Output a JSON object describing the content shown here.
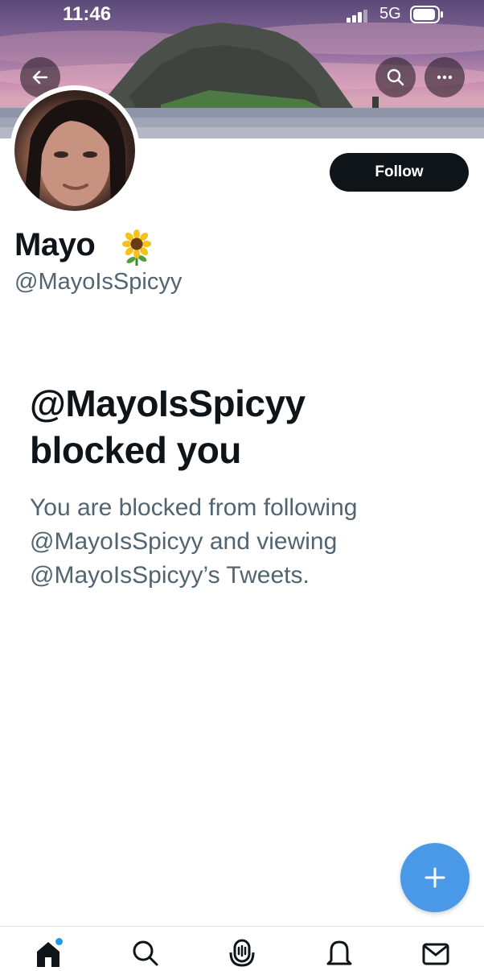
{
  "status_bar": {
    "time": "11:46",
    "network": "5G"
  },
  "profile": {
    "name": "Mayo",
    "name_emoji_icon": "sunflower-icon",
    "handle": "@MayoIsSpicyy",
    "follow_label": "Follow"
  },
  "blocked": {
    "title_line1": "@MayoIsSpicyy",
    "title_line2": "blocked you",
    "desc_line1": "You are blocked from following",
    "desc_line2": "@MayoIsSpicyy and viewing",
    "desc_line3": "@MayoIsSpicyy’s Tweets."
  },
  "tabbar": {
    "items": [
      "home-icon",
      "search-icon",
      "spaces-icon",
      "notifications-icon",
      "messages-icon"
    ]
  },
  "colors": {
    "accent": "#1d9bf0",
    "fab": "#4a99e9",
    "text": "#0f1419",
    "muted": "#536471"
  }
}
